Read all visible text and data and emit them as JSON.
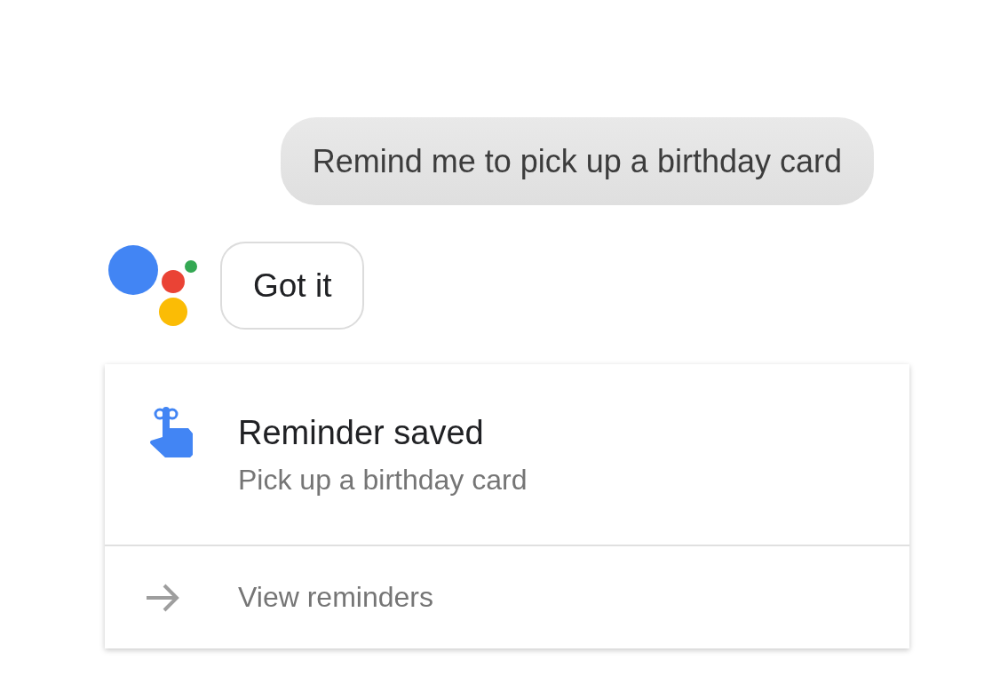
{
  "user_message": {
    "text": "Remind me to pick up a birthday card"
  },
  "assistant_reply": {
    "text": "Got it"
  },
  "reminder_card": {
    "title": "Reminder saved",
    "subtitle": "Pick up a birthday card",
    "action": {
      "label": "View reminders"
    }
  }
}
